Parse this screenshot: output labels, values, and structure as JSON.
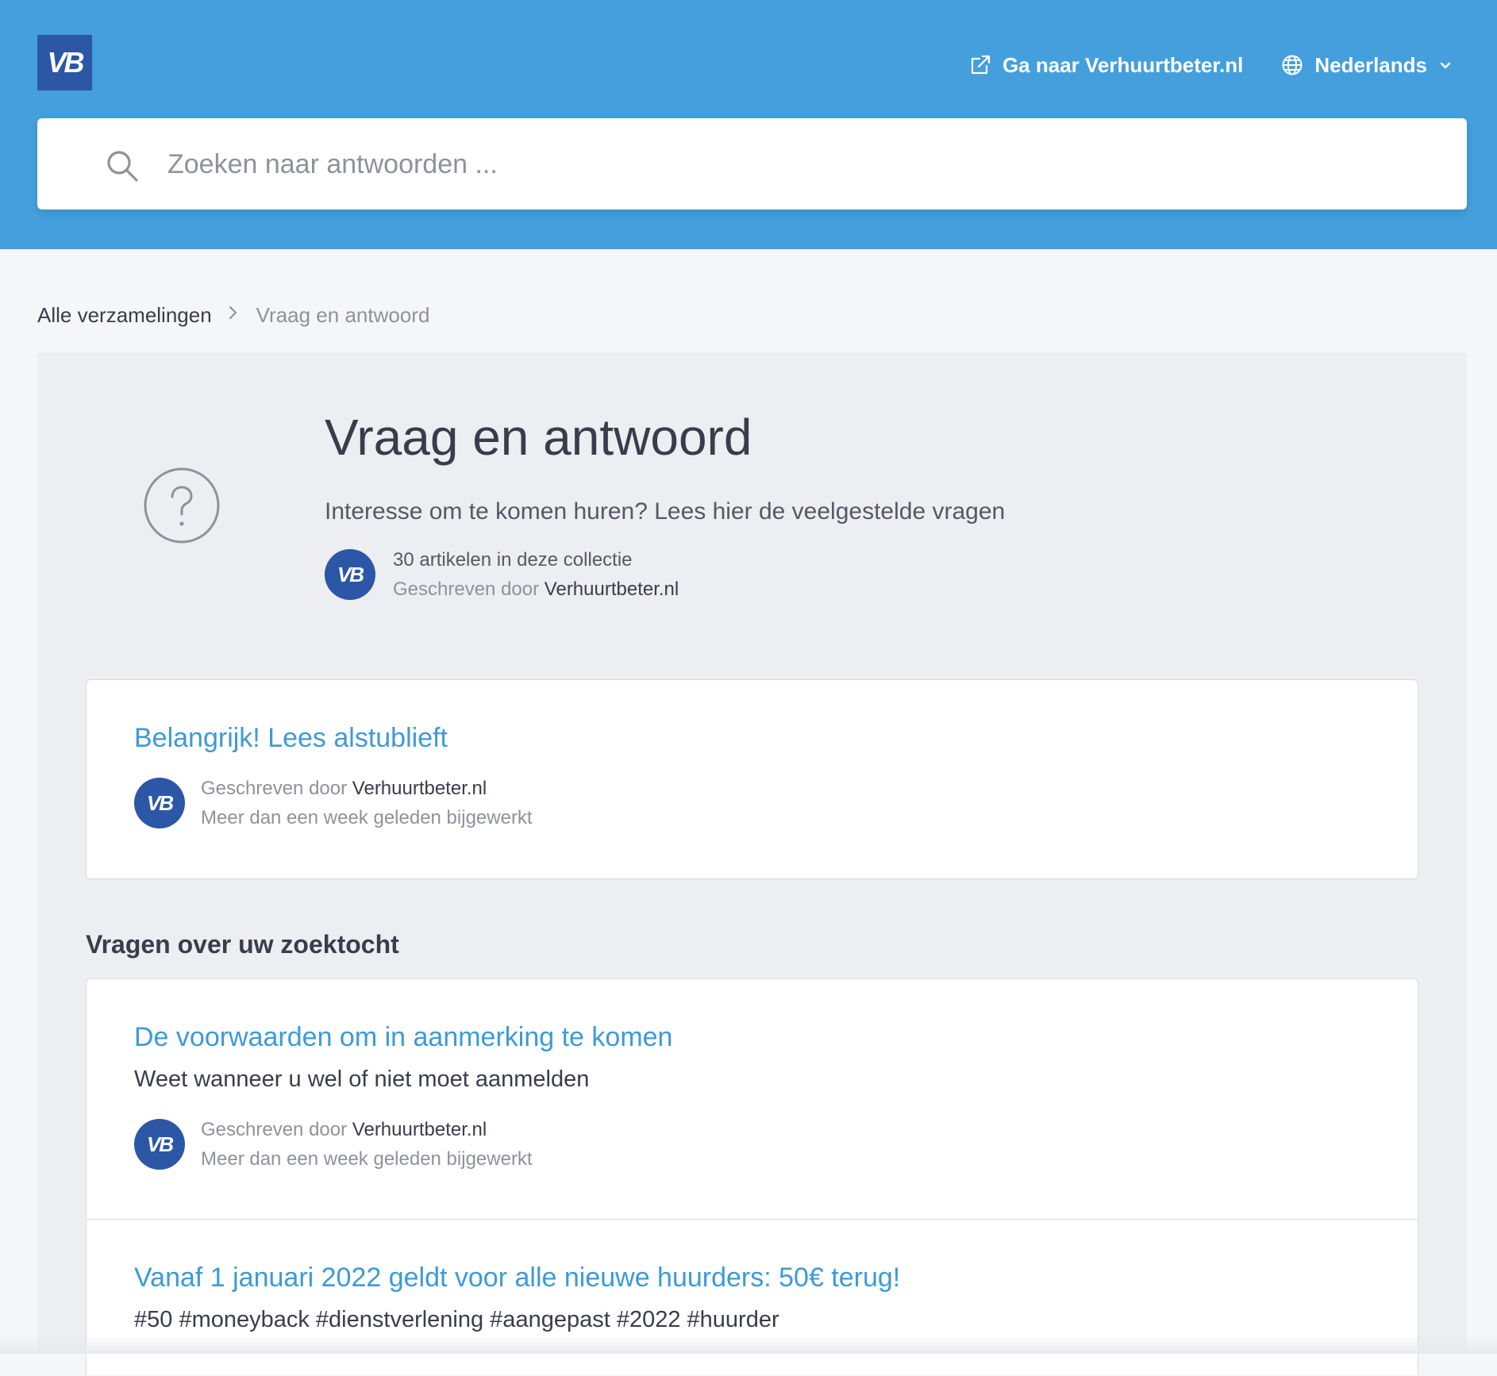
{
  "header": {
    "logo_text": "VB",
    "external_link_label": "Ga naar Verhuurtbeter.nl",
    "language_label": "Nederlands",
    "icons": {
      "external": "external-link-icon",
      "globe": "globe-icon",
      "chevron": "chevron-down-icon"
    }
  },
  "search": {
    "placeholder": "Zoeken naar antwoorden ...",
    "value": "",
    "icon": "search-icon"
  },
  "breadcrumb": {
    "root": "Alle verzamelingen",
    "current": "Vraag en antwoord"
  },
  "collection": {
    "icon": "question-circle-icon",
    "title": "Vraag en antwoord",
    "description": "Interesse om te komen huren? Lees hier de veelgestelde vragen",
    "article_count": "30 artikelen in deze collectie",
    "written_by_prefix": "Geschreven door",
    "author": "Verhuurtbeter.nl"
  },
  "featured_article": {
    "title": "Belangrijk! Lees alstublieft",
    "written_by_prefix": "Geschreven door",
    "author": "Verhuurtbeter.nl",
    "updated": "Meer dan een week geleden bijgewerkt"
  },
  "section": {
    "heading": "Vragen over uw zoektocht",
    "articles": [
      {
        "title": "De voorwaarden om in aanmerking te komen",
        "subtitle": "Weet wanneer u wel of niet moet aanmelden",
        "written_by_prefix": "Geschreven door",
        "author": "Verhuurtbeter.nl",
        "updated": "Meer dan een week geleden bijgewerkt"
      },
      {
        "title": "Vanaf 1 januari 2022 geldt voor alle nieuwe huurders: 50€ terug!",
        "subtitle": "#50 #moneyback #dienstverlening #aangepast #2022 #huurder"
      }
    ]
  },
  "colors": {
    "header_bg": "#449fdc",
    "brand_blue": "#2c56a6",
    "link_blue": "#3d9ad8",
    "panel_bg": "#edeef1",
    "page_bg": "#f5f6f7"
  }
}
